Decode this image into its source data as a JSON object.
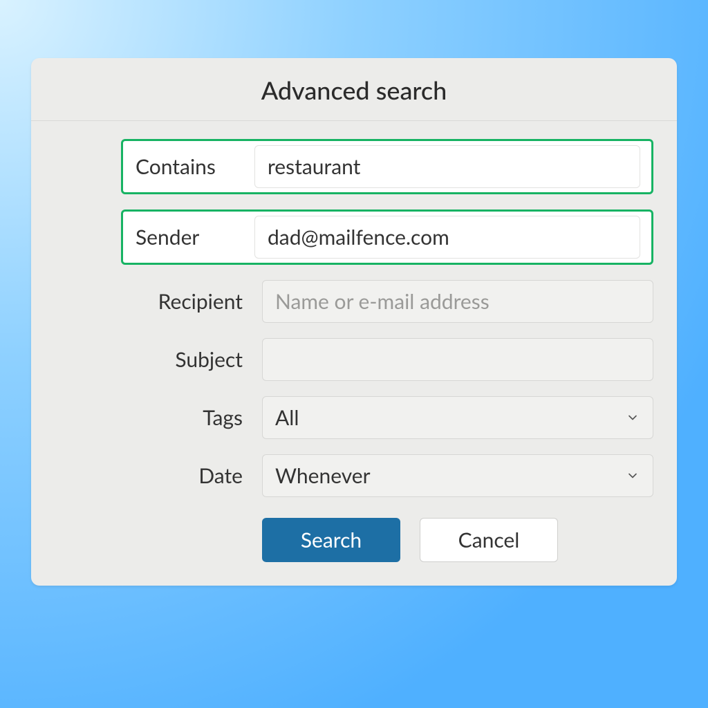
{
  "dialog": {
    "title": "Advanced search",
    "fields": {
      "contains": {
        "label": "Contains",
        "value": "restaurant",
        "placeholder": ""
      },
      "sender": {
        "label": "Sender",
        "value": "dad@mailfence.com",
        "placeholder": ""
      },
      "recipient": {
        "label": "Recipient",
        "value": "",
        "placeholder": "Name or e-mail address"
      },
      "subject": {
        "label": "Subject",
        "value": "",
        "placeholder": ""
      },
      "tags": {
        "label": "Tags",
        "value": "All"
      },
      "date": {
        "label": "Date",
        "value": "Whenever"
      }
    },
    "buttons": {
      "search": "Search",
      "cancel": "Cancel"
    }
  }
}
